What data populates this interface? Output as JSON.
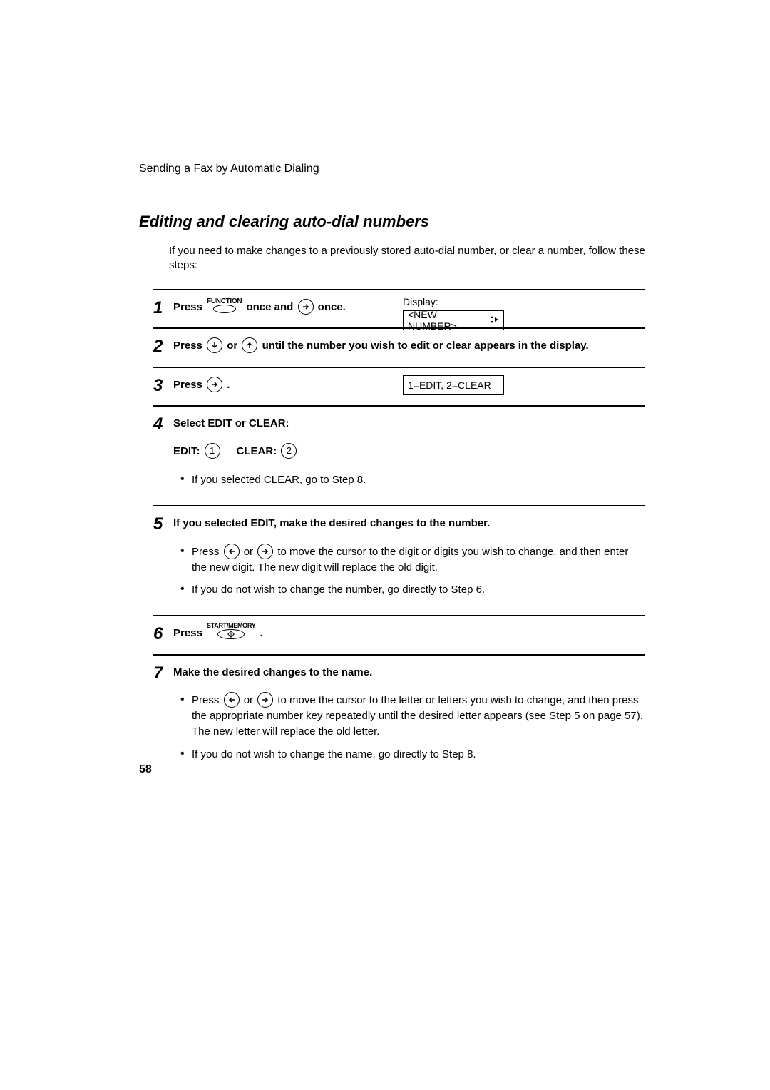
{
  "runningHead": "Sending a Fax by Automatic Dialing",
  "sectionTitle": "Editing and clearing auto-dial numbers",
  "intro": "If you need to make changes to a previously stored auto-dial number, or clear a number, follow these steps:",
  "displayLabel": "Display:",
  "display1": "<NEW NUMBER>",
  "display2": "1=EDIT, 2=CLEAR",
  "step1": {
    "num": "1",
    "press": "Press ",
    "funcLabel": "FUNCTION",
    "mid": " once and ",
    "tail": " once."
  },
  "step2": {
    "num": "2",
    "a": "Press ",
    "b": " or ",
    "c": " until the number you wish to edit or clear appears in the display."
  },
  "step3": {
    "num": "3",
    "a": "Press ",
    "b": " ."
  },
  "step4": {
    "num": "4",
    "head": "Select EDIT or CLEAR:",
    "editLbl": "EDIT: ",
    "editDigit": "1",
    "clearLbl": "CLEAR: ",
    "clearDigit": "2",
    "bullet": "If you selected CLEAR, go to Step 8."
  },
  "step5": {
    "num": "5",
    "head": "If you selected EDIT, make the desired changes to the number.",
    "b1a": "Press ",
    "b1b": " or ",
    "b1c": " to move the cursor to the digit or digits you wish to change, and then enter the new digit. The new digit will replace the old digit.",
    "b2": "If you do not wish to change the number, go directly to Step 6."
  },
  "step6": {
    "num": "6",
    "a": "Press ",
    "smLabel": "START/MEMORY",
    "b": " ."
  },
  "step7": {
    "num": "7",
    "head": "Make the desired changes to the name.",
    "b1a": "Press ",
    "b1b": " or ",
    "b1c": " to move the cursor to the letter or letters you wish to change, and then press the appropriate number key repeatedly until the desired letter appears (see Step 5 on page 57). The new letter will replace the old letter.",
    "b2": "If you do not wish to change the name, go directly to Step 8."
  },
  "pageNumber": "58"
}
